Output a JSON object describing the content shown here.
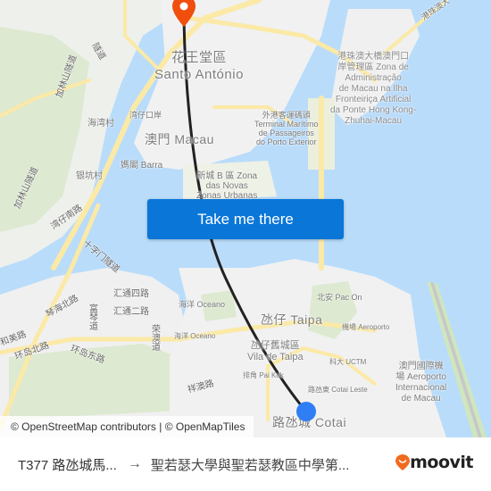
{
  "colors": {
    "water": "#b9dcfb",
    "land": "#f2f2f2",
    "park": "#dde9d0",
    "road": "#fbe9a6",
    "button": "#0a76d8",
    "destination_pin": "#f04e0d",
    "origin_dot": "#2f7ef5",
    "route_line": "#222222",
    "moovit_orange": "#f26b1d"
  },
  "map": {
    "labels": {
      "santo_antonio_zh": "花王堂區",
      "santo_antonio_pt": "Santo António",
      "macau": "澳門 Macau",
      "barra": "媽閣 Barra",
      "hai_wan": "海湾村",
      "yin_keng": "银坑村",
      "wan_zai_kou_an": "湾仔口岸",
      "ferry_terminal": [
        "外港客運碼頭",
        "Terminal Marítimo",
        "de Passageiros",
        "do Porto Exterior"
      ],
      "zona_b": [
        "新城 B 區 Zona",
        "das Novas",
        "Zonas Urbanas"
      ],
      "hzmb_zone": [
        "港珠澳大橋澳門口",
        "岸管理區 Zona de",
        "Administração",
        "de Macau na Ilha",
        "Fronteiriça Artificial",
        "da Ponte Hong Kong-",
        "Zhuhai-Macau"
      ],
      "hzmb_road": "港珠澳大",
      "taipa": "氹仔 Taipa",
      "vila_taipa": [
        "氹仔舊城區",
        "Vila de Taipa"
      ],
      "oceano_1": "海洋 Oceano",
      "oceano_2": "海洋 Oceano",
      "pac_on": "北安 Pac On",
      "aeroporto": "機場 Aeroporto",
      "uctm": "科大 UCTM",
      "cotai_leste": "路氹東 Cotai Leste",
      "pai_kok": "排角 Pai Kok",
      "cotai": "路氹城 Cotai",
      "airport": [
        "澳門國際機",
        "場 Aeroporto",
        "Internacional",
        "de Macau"
      ],
      "roads": {
        "jialin_tunnel_1": "加林山隧道",
        "jialin_tunnel_2": "加林山隧道",
        "wanzai_road": "湾仔南路",
        "shizimen_tunnel": "十字门隧道",
        "qinhai_north": "琴海北路",
        "fuqin": "富琴道",
        "huitong_4": "汇通四路",
        "huitong_2": "汇通二路",
        "rongao": "荣澳道",
        "hemei": "和美路",
        "huandao_north": "环岛北路",
        "huandao_east": "环岛东路",
        "xiangao": "祥澳路",
        "tunnel_top": "隧道"
      }
    }
  },
  "cta": {
    "label": "Take me there"
  },
  "attribution": {
    "text": "© OpenStreetMap contributors | © OpenMapTiles"
  },
  "footer": {
    "from": "T377 路氹城馬...",
    "arrow": "→",
    "to": "聖若瑟大學與聖若瑟教區中學第...",
    "brand": "moovit"
  }
}
